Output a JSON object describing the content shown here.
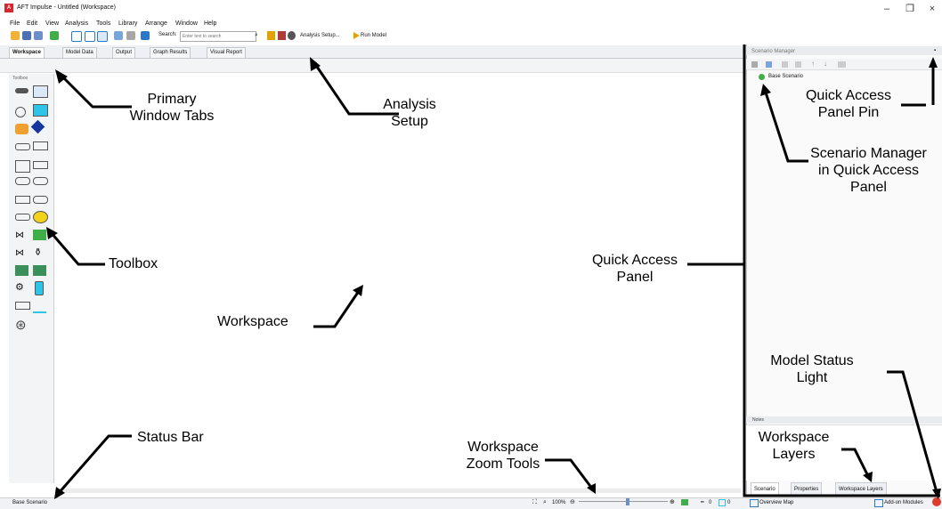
{
  "titlebar": {
    "app_title": "AFT Impulse - Untitled (Workspace)"
  },
  "menu": [
    "File",
    "Edit",
    "View",
    "Analysis",
    "Tools",
    "Library",
    "Arrange",
    "Window",
    "Help"
  ],
  "toolbar": {
    "search_label": "Search:",
    "search_placeholder": "Enter text to search",
    "analysis_setup": "Analysis Setup...",
    "run_model": "Run Model"
  },
  "tabs": [
    "Workspace",
    "Model Data",
    "Output",
    "Graph Results",
    "Visual Report"
  ],
  "toolbox": {
    "title": "Toolbox"
  },
  "scenario_manager": {
    "title": "Scenario Manager",
    "base_scenario": "Base Scenario"
  },
  "notes": {
    "label": "Notes"
  },
  "bottom_tabs": [
    "Scenario",
    "Properties",
    "Workspace Layers"
  ],
  "status": {
    "left": "Base Scenario",
    "zoom": "100%",
    "overview_map": "Overview Map",
    "addon_modules": "Add-on Modules",
    "count1": "0",
    "count2": "0"
  },
  "annotations": {
    "primary_tabs": "Primary Window Tabs",
    "analysis_setup": "Analysis Setup",
    "qap_pin": "Quick Access Panel Pin",
    "scenario_manager": "Scenario Manager in Quick Access Panel",
    "toolbox": "Toolbox",
    "quick_access_panel": "Quick Access Panel",
    "workspace": "Workspace",
    "model_status_light": "Model Status Light",
    "workspace_layers": "Workspace Layers",
    "status_bar": "Status Bar",
    "zoom_tools": "Workspace Zoom Tools"
  },
  "colors": {
    "accent": "#d8262c",
    "status_light": "#e03a2c",
    "scenario_ok": "#3fae49"
  }
}
